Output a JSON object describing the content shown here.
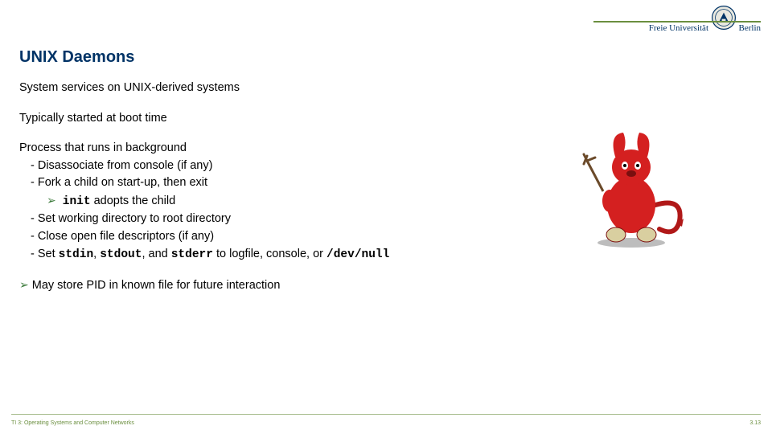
{
  "header": {
    "university_pre": "Freie Universität",
    "university_post": "Berlin",
    "seal_label": "university-seal"
  },
  "slide": {
    "title": "UNIX Daemons",
    "p1": "System services on UNIX-derived systems",
    "p2": "Typically started at boot time",
    "p3": "Process that runs in background",
    "b1": "Disassociate from console (if any)",
    "b2": "Fork a child on start-up, then exit",
    "b2a_pre": "",
    "b2a_code": "init",
    "b2a_post": " adopts the child",
    "b3": "Set working directory to root directory",
    "b4": "Close open file descriptors (if any)",
    "b5_pre": "Set ",
    "b5_c1": "stdin",
    "b5_m1": ", ",
    "b5_c2": "stdout",
    "b5_m2": ", and ",
    "b5_c3": "stderr",
    "b5_m3": " to logfile, console, or ",
    "b5_c4": "/dev/null",
    "p4": "May store PID in known file for future interaction"
  },
  "footer": {
    "left": "TI 3: Operating Systems and Computer Networks",
    "right": "3.13"
  },
  "mascot": {
    "alt": "BSD Daemon mascot"
  }
}
